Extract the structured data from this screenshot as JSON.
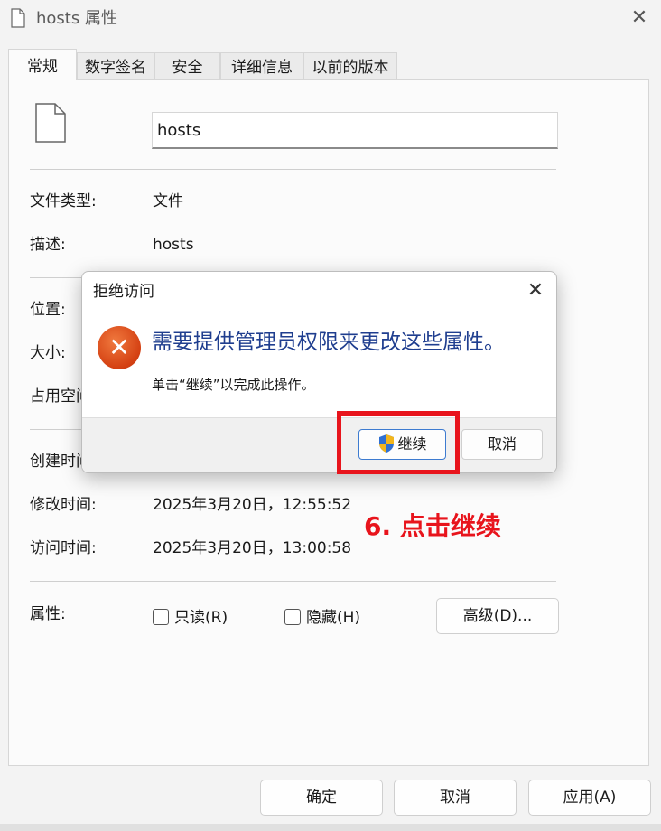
{
  "window": {
    "title": "hosts 属性",
    "close_glyph": "✕"
  },
  "tabs": [
    {
      "label": "常规",
      "active": true
    },
    {
      "label": "数字签名",
      "active": false
    },
    {
      "label": "安全",
      "active": false
    },
    {
      "label": "详细信息",
      "active": false
    },
    {
      "label": "以前的版本",
      "active": false
    }
  ],
  "general": {
    "file_name": "hosts",
    "rows": {
      "type": {
        "label": "文件类型:",
        "value": "文件"
      },
      "description": {
        "label": "描述:",
        "value": "hosts"
      },
      "location": {
        "label": "位置:"
      },
      "size": {
        "label": "大小:"
      },
      "size_on_disk": {
        "label": "占用空间:"
      },
      "created": {
        "label": "创建时间:"
      },
      "modified": {
        "label": "修改时间:",
        "value": "2025年3月20日，12:55:52"
      },
      "accessed": {
        "label": "访问时间:",
        "value": "2025年3月20日，13:00:58"
      }
    },
    "attributes": {
      "label": "属性:",
      "readonly": "只读(R)",
      "hidden": "隐藏(H)",
      "advanced": "高级(D)..."
    }
  },
  "footer": {
    "ok": "确定",
    "cancel": "取消",
    "apply": "应用(A)"
  },
  "dialog": {
    "title": "拒绝访问",
    "close_glyph": "✕",
    "message": "需要提供管理员权限来更改这些属性。",
    "detail": "单击“继续”以完成此操作。",
    "continue": "继续",
    "cancel": "取消",
    "error_glyph": "✕"
  },
  "annotation": {
    "text": "6. 点击继续",
    "color": "#e8141c"
  },
  "colors": {
    "dialog_message": "#1f3e8f",
    "error_icon": "#d44012",
    "background": "#f3f3f3"
  }
}
